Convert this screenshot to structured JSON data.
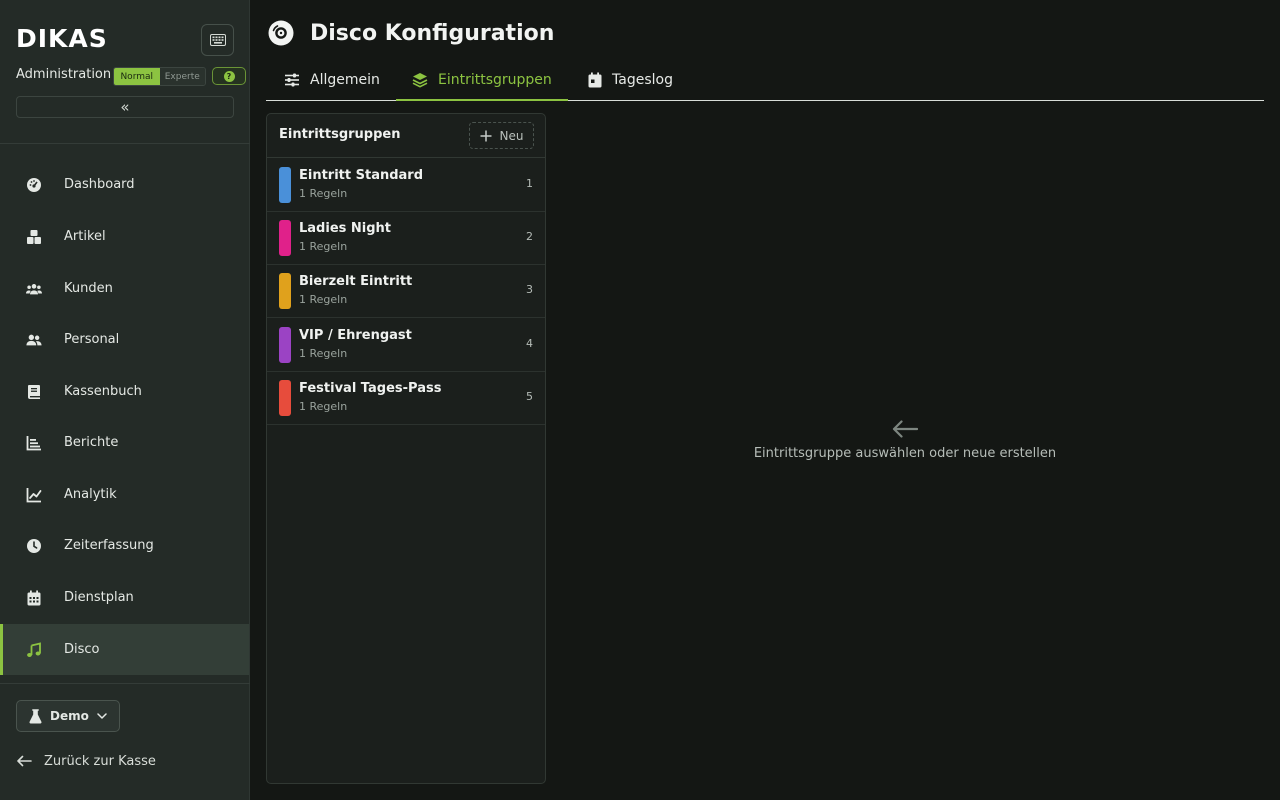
{
  "brand": {
    "logo_text": "DIKAS",
    "accent": "#8cc341"
  },
  "sidebar": {
    "admin_label": "Administration",
    "mode_options": [
      {
        "label": "Normal",
        "active": true
      },
      {
        "label": "Experte",
        "active": false
      }
    ],
    "help_label": "?",
    "collapse_icon": "«",
    "items": [
      {
        "label": "Dashboard",
        "icon": "dashboard-icon",
        "active": false
      },
      {
        "label": "Artikel",
        "icon": "boxes-icon",
        "active": false
      },
      {
        "label": "Kunden",
        "icon": "users-icon",
        "active": false
      },
      {
        "label": "Personal",
        "icon": "staff-icon",
        "active": false
      },
      {
        "label": "Kassenbuch",
        "icon": "book-icon",
        "active": false
      },
      {
        "label": "Berichte",
        "icon": "report-icon",
        "active": false
      },
      {
        "label": "Analytik",
        "icon": "chart-line-icon",
        "active": false
      },
      {
        "label": "Zeiterfassung",
        "icon": "clock-icon",
        "active": false
      },
      {
        "label": "Dienstplan",
        "icon": "calendar-icon",
        "active": false
      },
      {
        "label": "Disco",
        "icon": "music-icon",
        "active": true
      }
    ],
    "demo_label": "Demo",
    "back_label": "Zurück zur Kasse"
  },
  "page": {
    "title": "Disco Konfiguration",
    "tabs": [
      {
        "label": "Allgemein",
        "icon": "sliders-icon",
        "active": false
      },
      {
        "label": "Eintrittsgruppen",
        "icon": "layers-icon",
        "active": true
      },
      {
        "label": "Tageslog",
        "icon": "calendar-day-icon",
        "active": false
      }
    ]
  },
  "groups_panel": {
    "title": "Eintrittsgruppen",
    "new_label": "Neu",
    "groups": [
      {
        "name": "Eintritt Standard",
        "rules": "1 Regeln",
        "number": "1",
        "color": "#4a90d9"
      },
      {
        "name": "Ladies Night",
        "rules": "1 Regeln",
        "number": "2",
        "color": "#e0218a"
      },
      {
        "name": "Bierzelt Eintritt",
        "rules": "1 Regeln",
        "number": "3",
        "color": "#e0a11c"
      },
      {
        "name": "VIP / Ehrengast",
        "rules": "1 Regeln",
        "number": "4",
        "color": "#9b43c4"
      },
      {
        "name": "Festival Tages-Pass",
        "rules": "1 Regeln",
        "number": "5",
        "color": "#e74c3c"
      }
    ]
  },
  "empty_state": {
    "text": "Eintrittsgruppe auswählen oder neue erstellen",
    "icon": "arrow-left-icon"
  }
}
